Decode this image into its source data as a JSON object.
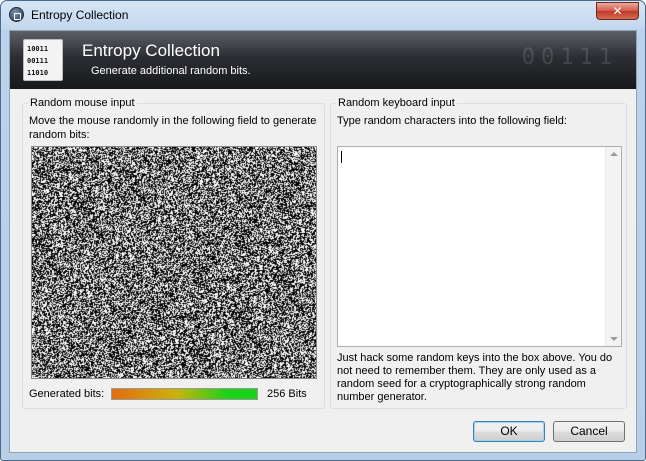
{
  "window": {
    "title": "Entropy Collection",
    "close_label": "✕"
  },
  "banner": {
    "title": "Entropy Collection",
    "subtitle": "Generate additional random bits.",
    "icon_lines": [
      "10011",
      "00111",
      "11010"
    ],
    "watermark": "00111"
  },
  "mouse_input": {
    "group_title": "Random mouse input",
    "description": "Move the mouse randomly in the following field to generate random bits:",
    "generated_label": "Generated bits:",
    "generated_progress": 1.0,
    "generated_value": "256 Bits"
  },
  "keyboard_input": {
    "group_title": "Random keyboard input",
    "description": "Type random characters into the following field:",
    "text_value": "",
    "hint": "Just hack some random keys into the box above. You do not need to remember them. They are only used as a random seed for a cryptographically strong random number generator."
  },
  "buttons": {
    "ok": "OK",
    "cancel": "Cancel"
  },
  "colors": {
    "banner_dark": "#17181b",
    "progress_start": "#e36d10",
    "progress_end": "#1bd21b"
  }
}
